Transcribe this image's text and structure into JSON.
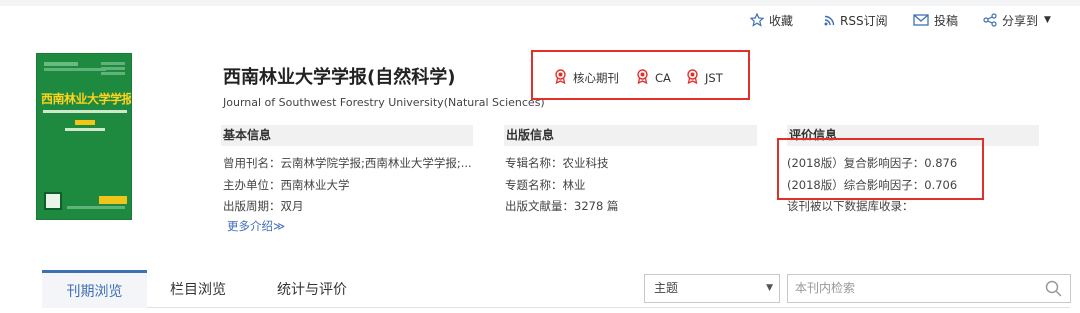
{
  "toolbar": {
    "favorite_label": "收藏",
    "rss_label": "RSS订阅",
    "submit_label": "投稿",
    "share_label": "分享到"
  },
  "cover": {
    "title": "西南林业大学学报"
  },
  "journal": {
    "title": "西南林业大学学报(自然科学)",
    "subtitle": "Journal of Southwest Forestry University(Natural Sciences)"
  },
  "badges": [
    {
      "label": "核心期刊"
    },
    {
      "label": "CA"
    },
    {
      "label": "JST"
    }
  ],
  "basic_info": {
    "heading": "基本信息",
    "rows": [
      {
        "label": "曾用刊名：",
        "value": "云南林学院学报;西南林业大学学报;..."
      },
      {
        "label": "主办单位：",
        "value": "西南林业大学"
      },
      {
        "label": "出版周期：",
        "value": "双月"
      }
    ],
    "more_link": "更多介绍≫"
  },
  "publish_info": {
    "heading": "出版信息",
    "rows": [
      {
        "label": "专辑名称：",
        "value": "农业科技"
      },
      {
        "label": "专题名称：",
        "value": "林业"
      },
      {
        "label": "出版文献量：",
        "value": "3278 篇"
      }
    ]
  },
  "eval_info": {
    "heading": "评价信息",
    "rows": [
      {
        "label": "(2018版）复合影响因子：",
        "value": "0.876"
      },
      {
        "label": "(2018版）综合影响因子：",
        "value": "0.706"
      },
      {
        "label": "该刊被以下数据库收录：",
        "value": ""
      }
    ]
  },
  "tabs": [
    {
      "label": "刊期浏览",
      "active": true
    },
    {
      "label": "栏目浏览",
      "active": false
    },
    {
      "label": "统计与评价",
      "active": false
    }
  ],
  "search": {
    "select_value": "主题",
    "placeholder": "本刊内检索"
  },
  "colors": {
    "accent": "#3f6fb5",
    "highlight_box": "#e0302c",
    "cover_green": "#1d8a3f",
    "cover_title": "#ffd21d"
  }
}
